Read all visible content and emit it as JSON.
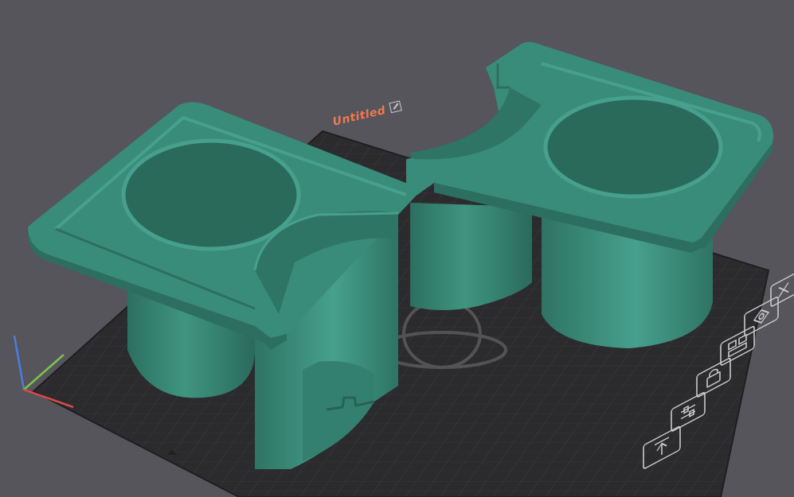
{
  "plate": {
    "label": "Untitled"
  },
  "colors": {
    "background": "#55555b",
    "bed": "#2b2b2e",
    "model": "#3a8c7a",
    "model_highlight": "#46a08d",
    "model_shadow": "#2c6f60",
    "label_accent": "#f2784b",
    "toolbar_icon": "#c9c9c9",
    "axis_x": "#e04a4a",
    "axis_y": "#7dc24a",
    "axis_z": "#4a7de0"
  },
  "plate_toolbar": [
    {
      "id": "close",
      "icon": "close-icon"
    },
    {
      "id": "orient",
      "icon": "auto-orient-icon"
    },
    {
      "id": "arrange",
      "icon": "arrange-icon"
    },
    {
      "id": "lock",
      "icon": "lock-icon"
    },
    {
      "id": "settings",
      "icon": "plate-settings-icon"
    },
    {
      "id": "pick",
      "icon": "pick-icon"
    }
  ]
}
